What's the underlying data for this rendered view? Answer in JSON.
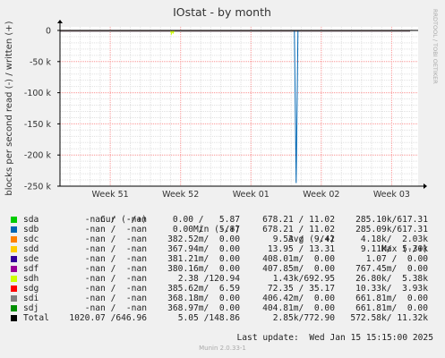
{
  "chart_data": {
    "type": "line",
    "title": "IOstat - by month",
    "ylabel": "blocks per second read (-) / written (+)",
    "ylim": [
      -250000,
      5000
    ],
    "y_ticks": [
      {
        "value": 0,
        "label": "0"
      },
      {
        "value": -50000,
        "label": "-50 k"
      },
      {
        "value": -100000,
        "label": "-100 k"
      },
      {
        "value": -150000,
        "label": "-150 k"
      },
      {
        "value": -200000,
        "label": "-200 k"
      },
      {
        "value": -250000,
        "label": "-250 k"
      }
    ],
    "x_range": [
      "2024-12-11",
      "2025-01-15"
    ],
    "x_ticks": [
      {
        "date": "2024-12-16",
        "label": "Week 51"
      },
      {
        "date": "2024-12-23",
        "label": "Week 52"
      },
      {
        "date": "2024-12-30",
        "label": "Week 01"
      },
      {
        "date": "2025-01-06",
        "label": "Week 02"
      },
      {
        "date": "2025-01-13",
        "label": "Week 03"
      }
    ],
    "grid": true,
    "side_label": "RRDTOOL / TOBI OETIKER",
    "series": [
      {
        "name": "sda",
        "color": "#00cc00",
        "cur": "-nan /  -nan",
        "min": "0.00 /   5.87",
        "avg": "678.21 / 11.02",
        "max": "285.10k/617.31"
      },
      {
        "name": "sdb",
        "color": "#0066b3",
        "cur": "-nan /  -nan",
        "min": "0.00 /   5.87",
        "avg": "678.21 / 11.02",
        "max": "285.09k/617.31"
      },
      {
        "name": "sdc",
        "color": "#ff8000",
        "cur": "-nan /  -nan",
        "min": "382.52m/  0.00",
        "avg": "9.53 /  9.42",
        "max": "4.18k/  2.03k"
      },
      {
        "name": "sdd",
        "color": "#ffcc00",
        "cur": "-nan /  -nan",
        "min": "367.94m/  0.00",
        "avg": "13.95 / 13.31",
        "max": "9.11k/  5.30k"
      },
      {
        "name": "sde",
        "color": "#330099",
        "cur": "-nan /  -nan",
        "min": "381.21m/  0.00",
        "avg": "408.01m/  0.00",
        "max": "1.07 /  0.00"
      },
      {
        "name": "sdf",
        "color": "#990099",
        "cur": "-nan /  -nan",
        "min": "380.16m/  0.00",
        "avg": "407.85m/  0.00",
        "max": "767.45m/  0.00"
      },
      {
        "name": "sdh",
        "color": "#ccff00",
        "cur": "-nan /  -nan",
        "min": "2.38 /120.94",
        "avg": "1.43k/692.95",
        "max": "26.80k/  5.38k"
      },
      {
        "name": "sdg",
        "color": "#ff0000",
        "cur": "-nan /  -nan",
        "min": "385.62m/  6.59",
        "avg": "72.35 / 35.17",
        "max": "10.33k/  3.93k"
      },
      {
        "name": "sdi",
        "color": "#808080",
        "cur": "-nan /  -nan",
        "min": "368.18m/  0.00",
        "avg": "406.42m/  0.00",
        "max": "661.81m/  0.00"
      },
      {
        "name": "sdj",
        "color": "#008f00",
        "cur": "-nan /  -nan",
        "min": "368.97m/  0.00",
        "avg": "404.81m/  0.00",
        "max": "661.81m/  0.00"
      },
      {
        "name": "Total",
        "color": "#000000",
        "cur": "1020.07 /646.96",
        "min": "5.05 /148.86",
        "avg": "2.85k/772.90",
        "max": "572.58k/ 11.32k"
      }
    ],
    "spike": {
      "series": "sdb",
      "date": "2025-01-03",
      "value": -245000
    }
  },
  "legend_headers": {
    "cur": "Cur (-/+)",
    "min": "Min (-/+)",
    "avg": "Avg (-/+)",
    "max": "Max (-/+)"
  },
  "footer": {
    "last_update": "Last update:  Wed Jan 15 15:15:00 2025",
    "version": "Munin 2.0.33-1"
  },
  "colors": {
    "background": "#f0f0f0",
    "plot_background": "#ffffff",
    "major_grid": "#ff9999",
    "minor_grid": "#e0e0e0",
    "spike": "#0066b3"
  }
}
